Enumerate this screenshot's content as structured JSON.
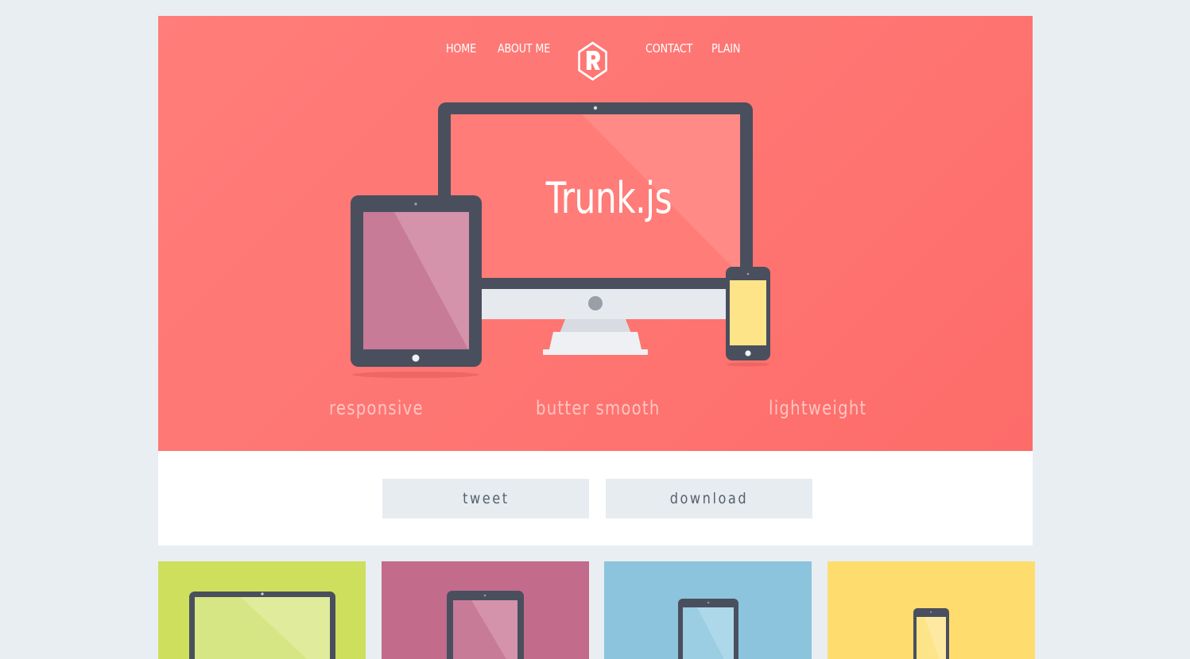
{
  "nav": {
    "items": [
      {
        "label": "HOME"
      },
      {
        "label": "ABOUT ME"
      },
      {
        "label": "CONTACT"
      },
      {
        "label": "PLAIN"
      }
    ],
    "logo_letter": "R"
  },
  "hero": {
    "title": "Trunk.js",
    "taglines": [
      "responsive",
      "butter smooth",
      "lightweight"
    ],
    "background": "#fe7572"
  },
  "actions": {
    "tweet_label": "tweet",
    "download_label": "download"
  },
  "tiles": [
    {
      "name": "laptop",
      "color": "#cddf5d"
    },
    {
      "name": "tablet",
      "color": "#c26b8a"
    },
    {
      "name": "phablet",
      "color": "#8bc4dc"
    },
    {
      "name": "phone",
      "color": "#fedd6e"
    }
  ],
  "colors": {
    "page_bg": "#e9eef2",
    "device_frame": "#4a4f5e",
    "button_bg": "#e7ecf0"
  }
}
